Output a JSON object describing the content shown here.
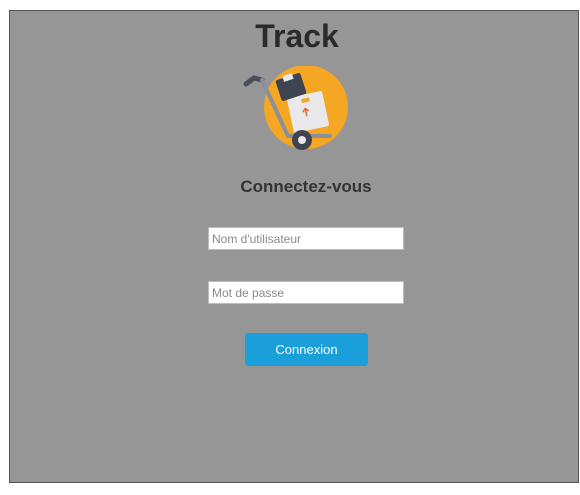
{
  "app": {
    "title": "Track"
  },
  "login": {
    "heading": "Connectez-vous",
    "username_placeholder": "Nom d'utilisateur",
    "username_value": "",
    "password_placeholder": "Mot de passe",
    "password_value": "",
    "submit_label": "Connexion"
  },
  "logo": {
    "icon": "hand-truck-with-boxes-icon"
  },
  "colors": {
    "background": "#969696",
    "button": "#1a9fdb",
    "logo_circle": "#f5a623",
    "title_text": "#2a2a2a"
  }
}
